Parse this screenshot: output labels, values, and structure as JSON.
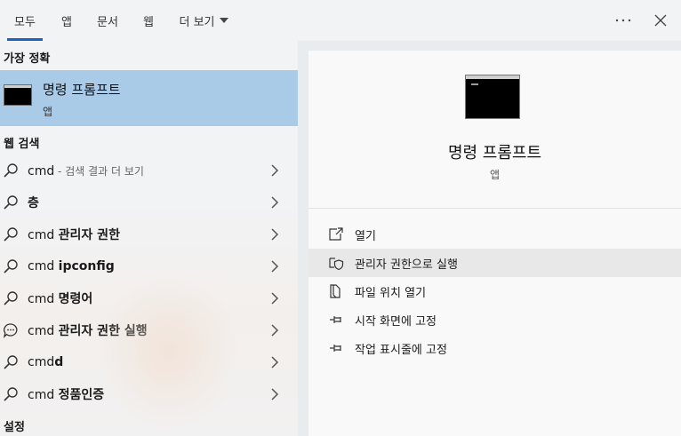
{
  "tabs": [
    {
      "label": "모두",
      "active": true
    },
    {
      "label": "앱"
    },
    {
      "label": "문서"
    },
    {
      "label": "웹"
    },
    {
      "label": "더 보기"
    }
  ],
  "left": {
    "best_match_header": "가장 정확",
    "best_match": {
      "title": "명령 프롬프트",
      "subtitle": "앱",
      "icon": "command-prompt-icon"
    },
    "web_header": "웹 검색",
    "results": [
      {
        "prefix": "cmd",
        "bold": "",
        "muted": " - 검색 결과 더 보기",
        "icon": "search-icon"
      },
      {
        "prefix": "",
        "bold": "층",
        "muted": "",
        "icon": "search-icon"
      },
      {
        "prefix": "cmd ",
        "bold": "관리자 권한",
        "muted": "",
        "icon": "search-icon"
      },
      {
        "prefix": "cmd ",
        "bold": "ipconfig",
        "muted": "",
        "icon": "search-icon"
      },
      {
        "prefix": "cmd ",
        "bold": "명령어",
        "muted": "",
        "icon": "search-icon"
      },
      {
        "prefix": "cmd ",
        "bold": "관리자 권한 실행",
        "muted": "",
        "icon": "chat-icon"
      },
      {
        "prefix": "cmd",
        "bold": "d",
        "muted": "",
        "icon": "search-icon"
      },
      {
        "prefix": "cmd ",
        "bold": "정품인증",
        "muted": "",
        "icon": "search-icon"
      }
    ],
    "settings_header": "설정"
  },
  "right": {
    "title": "명령 프롬프트",
    "subtitle": "앱",
    "actions": [
      {
        "label": "열기",
        "icon": "open-icon"
      },
      {
        "label": "관리자 권한으로 실행",
        "icon": "shield-icon"
      },
      {
        "label": "파일 위치 열기",
        "icon": "file-location-icon"
      },
      {
        "label": "시작 화면에 고정",
        "icon": "pin-icon"
      },
      {
        "label": "작업 표시줄에 고정",
        "icon": "pin-icon"
      }
    ]
  },
  "colors": {
    "accent": "#1f5fbf",
    "selected": "#a9cbe8",
    "hover": "#e8e8e8"
  }
}
